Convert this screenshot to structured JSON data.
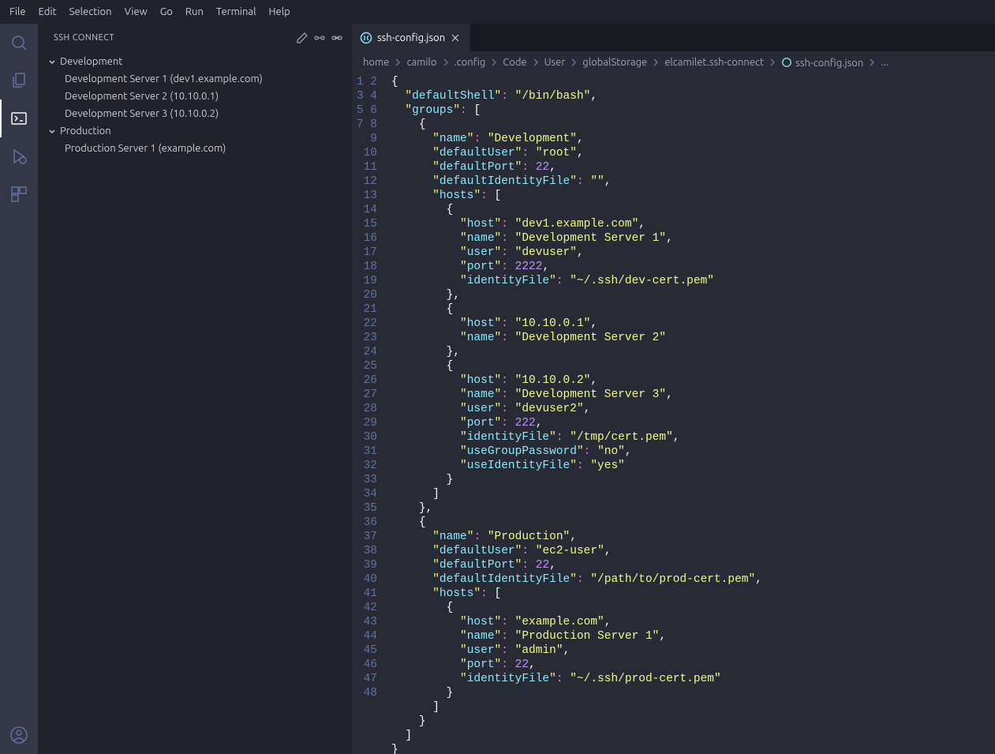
{
  "menubar": [
    "File",
    "Edit",
    "Selection",
    "View",
    "Go",
    "Run",
    "Terminal",
    "Help"
  ],
  "sidebar": {
    "title": "SSH CONNECT",
    "groups": [
      {
        "label": "Development",
        "items": [
          "Development Server 1 (dev1.example.com)",
          "Development Server 2 (10.10.0.1)",
          "Development Server 3 (10.10.0.2)"
        ]
      },
      {
        "label": "Production",
        "items": [
          "Production Server 1 (example.com)"
        ]
      }
    ]
  },
  "tab": {
    "label": "ssh-config.json"
  },
  "breadcrumbs": [
    "home",
    "camilo",
    ".config",
    "Code",
    "User",
    "globalStorage",
    "elcamilet.ssh-connect",
    "ssh-config.json",
    "..."
  ],
  "code": {
    "defaultShell": "/bin/bash",
    "groups": [
      {
        "name": "Development",
        "defaultUser": "root",
        "defaultPort": 22,
        "defaultIdentityFile": "",
        "hosts": [
          {
            "host": "dev1.example.com",
            "name": "Development Server 1",
            "user": "devuser",
            "port": 2222,
            "identityFile": "~/.ssh/dev-cert.pem"
          },
          {
            "host": "10.10.0.1",
            "name": "Development Server 2"
          },
          {
            "host": "10.10.0.2",
            "name": "Development Server 3",
            "user": "devuser2",
            "port": 222,
            "identityFile": "/tmp/cert.pem",
            "useGroupPassword": "no",
            "useIdentityFile": "yes"
          }
        ]
      },
      {
        "name": "Production",
        "defaultUser": "ec2-user",
        "defaultPort": 22,
        "defaultIdentityFile": "/path/to/prod-cert.pem",
        "hosts": [
          {
            "host": "example.com",
            "name": "Production Server 1",
            "user": "admin",
            "port": 22,
            "identityFile": "~/.ssh/prod-cert.pem"
          }
        ]
      }
    ]
  },
  "lineCount": 48
}
